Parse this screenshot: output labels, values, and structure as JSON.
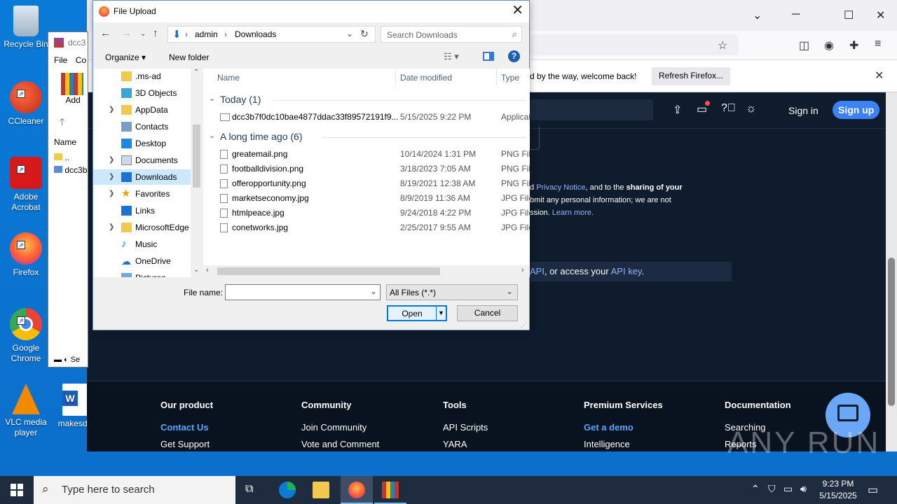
{
  "desktop": {
    "icons": [
      {
        "label": "Recycle Bin"
      },
      {
        "label": "CCleaner"
      },
      {
        "label": "Adobe Acrobat"
      },
      {
        "label": "Firefox"
      },
      {
        "label": "Google Chrome"
      },
      {
        "label": "VLC media player"
      },
      {
        "label": "makesdu"
      }
    ]
  },
  "winrar": {
    "title": "dcc3",
    "menu_file": "File",
    "menu_co": "Co",
    "add_label": "Add",
    "col_name": "Name",
    "row_up": "..",
    "row_file": "dcc3b",
    "status": "Se"
  },
  "firefox": {
    "notice_text": "d by the way, welcome back!",
    "refresh_button": "Refresh Firefox...",
    "signin": "Sign in",
    "signup": "Sign up",
    "privacy_prefix": "d ",
    "privacy_link": "Privacy Notice",
    "privacy_mid": ", and to the ",
    "privacy_bold": "sharing of your",
    "privacy_line2": "bmit any personal information; we are not",
    "privacy_line3": "ssion. ",
    "learn_more": "Learn more.",
    "api_prefix": "API",
    "api_mid": ", or access your ",
    "api_key": "API key",
    "api_suffix": ".",
    "footer": {
      "cols": [
        {
          "heading": "Our product",
          "links": [
            "Contact Us",
            "Get Support"
          ],
          "highlight": 0
        },
        {
          "heading": "Community",
          "links": [
            "Join Community",
            "Vote and Comment"
          ],
          "highlight": -1
        },
        {
          "heading": "Tools",
          "links": [
            "API Scripts",
            "YARA"
          ],
          "highlight": -1
        },
        {
          "heading": "Premium Services",
          "links": [
            "Get a demo",
            "Intelligence"
          ],
          "highlight": 0
        },
        {
          "heading": "Documentation",
          "links": [
            "Searching",
            "Reports"
          ],
          "highlight": -1
        }
      ]
    }
  },
  "dialog": {
    "title": "File Upload",
    "breadcrumb": [
      "admin",
      "Downloads"
    ],
    "search_placeholder": "Search Downloads",
    "organize": "Organize",
    "new_folder": "New folder",
    "tree": [
      ".ms-ad",
      "3D Objects",
      "AppData",
      "Contacts",
      "Desktop",
      "Documents",
      "Downloads",
      "Favorites",
      "Links",
      "MicrosoftEdge",
      "Music",
      "OneDrive",
      "Pictures"
    ],
    "tree_selected": "Downloads",
    "columns": {
      "name": "Name",
      "date": "Date modified",
      "type": "Type"
    },
    "groups": [
      {
        "label": "Today (1)",
        "files": [
          {
            "name": "dcc3b7f0dc10bae4877ddac33f89572191f9...",
            "date": "5/15/2025 9:22 PM",
            "type": "Applicat"
          }
        ]
      },
      {
        "label": "A long time ago (6)",
        "files": [
          {
            "name": "greatemail.png",
            "date": "10/14/2024 1:31 PM",
            "type": "PNG File"
          },
          {
            "name": "footballdivision.png",
            "date": "3/18/2023 7:05 AM",
            "type": "PNG File"
          },
          {
            "name": "offeropportunity.png",
            "date": "8/19/2021 12:38 AM",
            "type": "PNG File"
          },
          {
            "name": "marketseconomy.jpg",
            "date": "8/9/2019 11:36 AM",
            "type": "JPG File"
          },
          {
            "name": "htmlpeace.jpg",
            "date": "9/24/2018 4:22 PM",
            "type": "JPG File"
          },
          {
            "name": "conetworks.jpg",
            "date": "2/25/2017 9:55 AM",
            "type": "JPG File"
          }
        ]
      }
    ],
    "filename_label": "File name:",
    "filename_value": "",
    "filetype": "All Files (*.*)",
    "open_button": "Open",
    "cancel_button": "Cancel"
  },
  "taskbar": {
    "search_placeholder": "Type here to search",
    "time": "9:23 PM",
    "date": "5/15/2025"
  },
  "watermark": "ANY RUN"
}
